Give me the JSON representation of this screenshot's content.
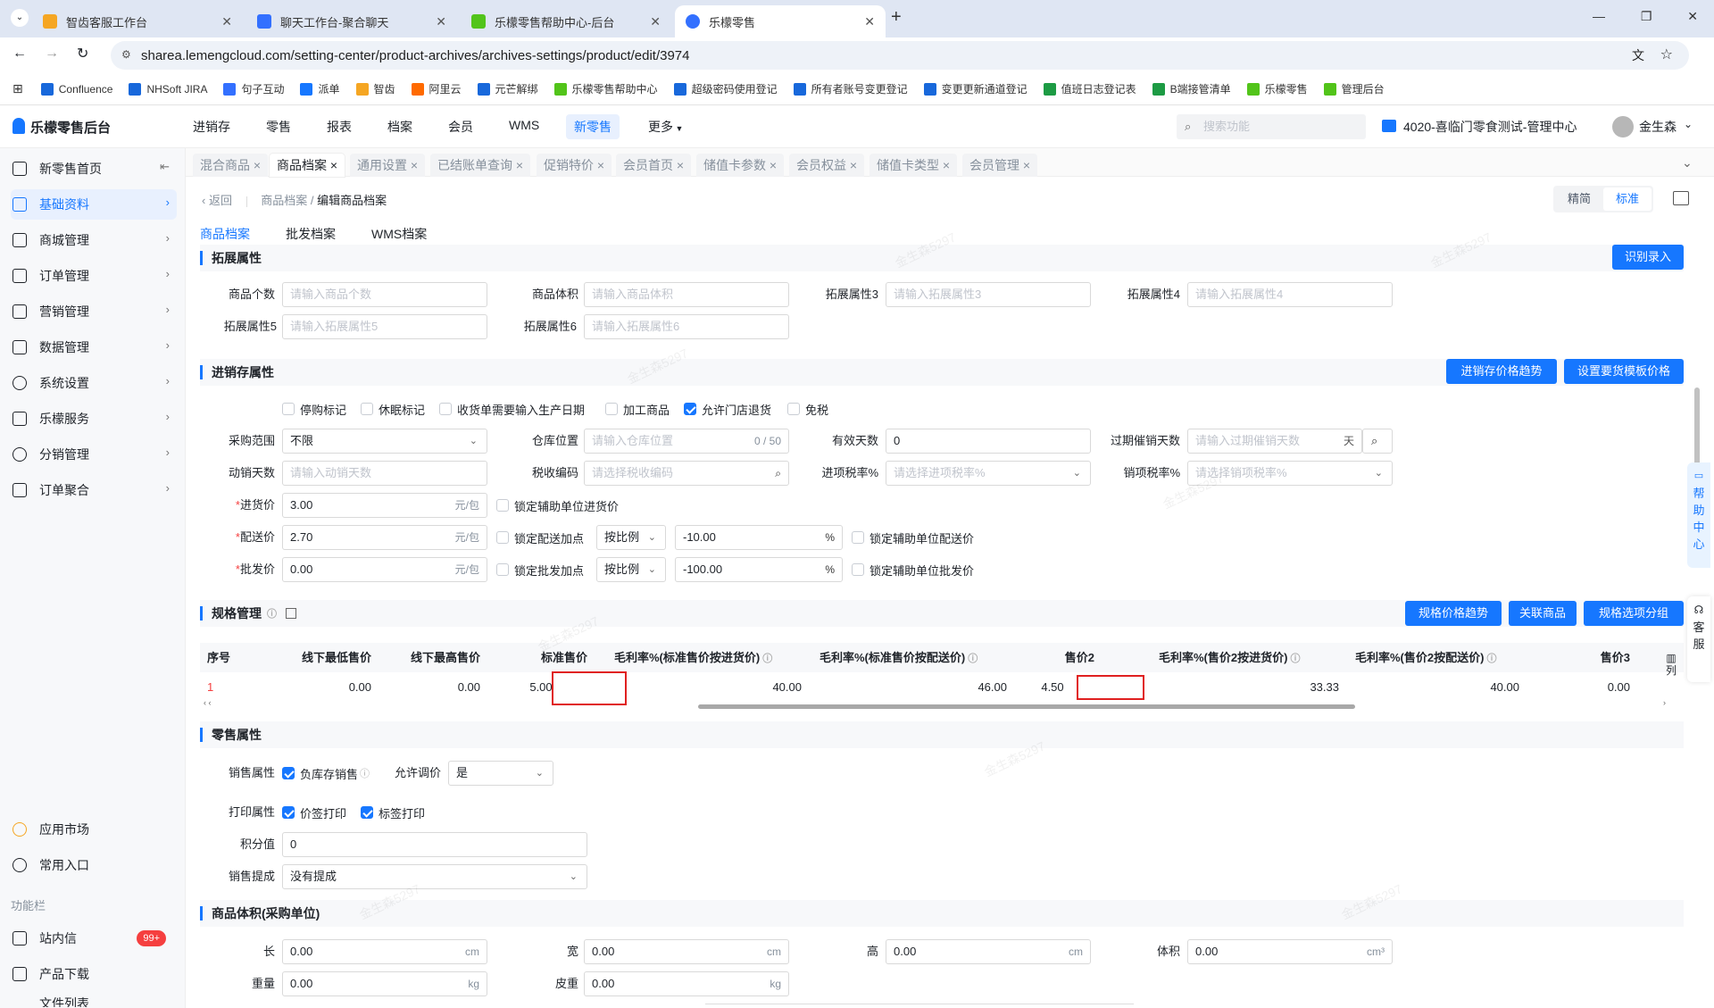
{
  "browser": {
    "tabs": [
      {
        "title": "智齿客服工作台",
        "color": "#f5a623"
      },
      {
        "title": "聊天工作台-聚合聊天",
        "color": "#3370ff"
      },
      {
        "title": "乐檬零售帮助中心-后台",
        "color": "#52c41a"
      },
      {
        "title": "乐檬零售",
        "color": "#3370ff"
      }
    ],
    "url": "sharea.lemengcloud.com/setting-center/product-archives/archives-settings/product/edit/3974",
    "bookmarks": [
      "Confluence",
      "NHSoft JIRA",
      "句子互动",
      "派单",
      "智齿",
      "阿里云",
      "元芒解绑",
      "乐檬零售帮助中心",
      "超级密码使用登记",
      "所有者账号变更登记",
      "变更更新通道登记",
      "值班日志登记表",
      "B端接管清单",
      "乐檬零售",
      "管理后台"
    ]
  },
  "app": {
    "logo": "乐檬零售后台",
    "nav": [
      "进销存",
      "零售",
      "报表",
      "档案",
      "会员",
      "WMS",
      "新零售",
      "更多"
    ],
    "search_placeholder": "搜索功能",
    "store": "4020-喜临门零食测试-管理中心",
    "user": "金生森"
  },
  "sidebar": {
    "items": [
      "新零售首页",
      "基础资料",
      "商城管理",
      "订单管理",
      "营销管理",
      "数据管理",
      "系统设置",
      "乐檬服务",
      "分销管理",
      "订单聚合"
    ],
    "bottom": [
      "应用市场",
      "常用入口"
    ],
    "func_title": "功能栏",
    "func": [
      "站内信",
      "产品下载",
      "文件列表"
    ],
    "badge": "99+"
  },
  "page_tabs": [
    "混合商品",
    "商品档案",
    "通用设置",
    "已结账单查询",
    "促销特价",
    "会员首页",
    "储值卡参数",
    "会员权益",
    "储值卡类型",
    "会员管理"
  ],
  "breadcrumb": {
    "back": "返回",
    "parent": "商品档案",
    "current": "编辑商品档案"
  },
  "view_toggle": [
    "精简",
    "标准"
  ],
  "sub_tabs": [
    "商品档案",
    "批发档案",
    "WMS档案"
  ],
  "ext": {
    "title": "拓展属性",
    "btn": "识别录入",
    "fields": [
      {
        "label": "商品个数",
        "ph": "请输入商品个数"
      },
      {
        "label": "商品体积",
        "ph": "请输入商品体积"
      },
      {
        "label": "拓展属性3",
        "ph": "请输入拓展属性3"
      },
      {
        "label": "拓展属性4",
        "ph": "请输入拓展属性4"
      },
      {
        "label": "拓展属性5",
        "ph": "请输入拓展属性5"
      },
      {
        "label": "拓展属性6",
        "ph": "请输入拓展属性6"
      }
    ]
  },
  "inv": {
    "title": "进销存属性",
    "btn1": "进销存价格趋势",
    "btn2": "设置要货模板价格",
    "checks": [
      {
        "label": "停购标记",
        "on": false
      },
      {
        "label": "休眠标记",
        "on": false
      },
      {
        "label": "收货单需要输入生产日期",
        "on": false
      },
      {
        "label": "加工商品",
        "on": false
      },
      {
        "label": "允许门店退货",
        "on": true
      },
      {
        "label": "免税",
        "on": false
      }
    ],
    "purchase_range_label": "采购范围",
    "purchase_range": "不限",
    "warehouse_label": "仓库位置",
    "warehouse_ph": "请输入仓库位置",
    "warehouse_count": "0 / 50",
    "valid_days_label": "有效天数",
    "valid_days": "0",
    "expire_label": "过期催销天数",
    "expire_ph": "请输入过期催销天数",
    "expire_unit": "天",
    "pin_days_label": "动销天数",
    "pin_days_ph": "请输入动销天数",
    "tax_code_label": "税收编码",
    "tax_code_ph": "请选择税收编码",
    "in_tax_label": "进项税率%",
    "in_tax_ph": "请选择进项税率%",
    "out_tax_label": "销项税率%",
    "out_tax_ph": "请选择销项税率%",
    "cost_label": "进货价",
    "cost": "3.00",
    "unit": "元/包",
    "lock_cost": "锁定辅助单位进货价",
    "dist_label": "配送价",
    "dist": "2.70",
    "lock_dist_add": "锁定配送加点",
    "dist_mode": "按比例",
    "dist_pct": "-10.00",
    "lock_dist": "锁定辅助单位配送价",
    "whole_label": "批发价",
    "whole": "0.00",
    "lock_whole_add": "锁定批发加点",
    "whole_mode": "按比例",
    "whole_pct": "-100.00",
    "lock_whole": "锁定辅助单位批发价",
    "pct": "%"
  },
  "spec": {
    "title": "规格管理",
    "btn1": "规格价格趋势",
    "btn2": "关联商品",
    "btn3": "规格选项分组",
    "headers": [
      "序号",
      "线下最低售价",
      "线下最高售价",
      "标准售价",
      "毛利率%(标准售价按进货价)",
      "毛利率%(标准售价按配送价)",
      "售价2",
      "毛利率%(售价2按进货价)",
      "毛利率%(售价2按配送价)",
      "售价3"
    ],
    "row": [
      "1",
      "0.00",
      "0.00",
      "5.00",
      "40.00",
      "46.00",
      "4.50",
      "33.33",
      "40.00",
      "0.00"
    ],
    "col_btn": "列"
  },
  "retail": {
    "title": "零售属性",
    "sale_label": "销售属性",
    "neg_stock": "负库存销售",
    "adjust_label": "允许调价",
    "adjust": "是",
    "print_label": "打印属性",
    "price_print": "价签打印",
    "tag_print": "标签打印",
    "points_label": "积分值",
    "points": "0",
    "commission_label": "销售提成",
    "commission": "没有提成"
  },
  "volume": {
    "title": "商品体积(采购单位)",
    "len_label": "长",
    "len": "0.00",
    "cm": "cm",
    "wid_label": "宽",
    "wid": "0.00",
    "hei_label": "高",
    "hei": "0.00",
    "vol_label": "体积",
    "vol": "0.00",
    "cm3": "cm³",
    "wt_label": "重量",
    "wt": "0.00",
    "kg": "kg",
    "tare_label": "皮重",
    "tare": "0.00"
  },
  "float": {
    "help": "帮助中心",
    "service": "客服"
  },
  "watermark": "金生森5297"
}
